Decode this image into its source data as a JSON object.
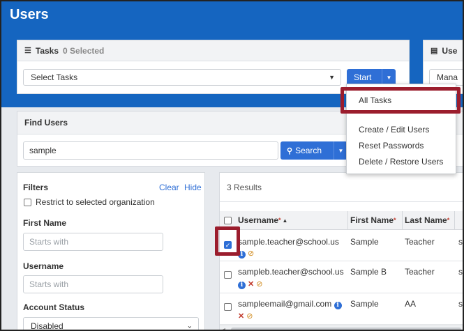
{
  "page": {
    "title": "Users"
  },
  "tasks": {
    "title": "Tasks",
    "selected_count": "0 Selected",
    "select_value": "Select Tasks",
    "start_label": "Start"
  },
  "users_panel": {
    "title_partial": "Use",
    "select_partial": "Mana"
  },
  "start_menu": {
    "items": [
      "All Tasks",
      "Create / Edit Users",
      "Reset Passwords",
      "Delete / Restore Users"
    ]
  },
  "find_users": {
    "title": "Find Users",
    "search_value": "sample",
    "search_label": "Search"
  },
  "filters": {
    "title": "Filters",
    "clear_label": "Clear",
    "hide_label": "Hide",
    "restrict_label": "Restrict to selected organization",
    "first_name_label": "First Name",
    "first_name_placeholder": "Starts with",
    "username_label": "Username",
    "username_placeholder": "Starts with",
    "account_status_label": "Account Status",
    "account_status_value": "Disabled"
  },
  "results": {
    "count_text": "3 Results",
    "columns": {
      "username": "Username",
      "first_name": "First Name",
      "last_name": "Last Name"
    },
    "rows": [
      {
        "username": "sample.teacher@school.us",
        "first_name": "Sample",
        "last_name": "Teacher",
        "checked": true
      },
      {
        "username": "sampleb.teacher@school.us",
        "first_name": "Sample B",
        "last_name": "Teacher",
        "checked": false
      },
      {
        "username": "sampleemail@gmail.com",
        "first_name": "Sample",
        "last_name": "AA",
        "checked": false
      }
    ]
  },
  "colors": {
    "header_blue": "#1565c0",
    "button_blue": "#2f6fd6",
    "highlight": "#9b1d2d"
  },
  "icons": [
    "tasks-list-icon",
    "search-icon",
    "info-icon",
    "disable-icon",
    "ban-icon",
    "sort-asc-icon"
  ]
}
